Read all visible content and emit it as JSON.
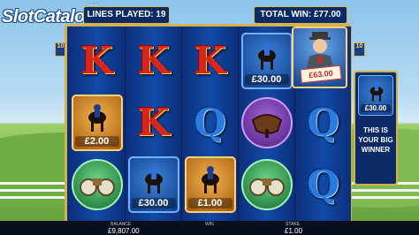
{
  "watermark": {
    "brand": "SlotCatalog",
    "suffix": ".com"
  },
  "header": {
    "lines_played_label": "LINES PLAYED:",
    "lines_played_value": "19",
    "total_win_label": "TOTAL WIN:",
    "total_win_value": "£77.00"
  },
  "winline_badges": {
    "left": "10",
    "right": "10"
  },
  "reels": [
    [
      {
        "kind": "letter",
        "value": "K"
      },
      {
        "kind": "horse",
        "prize": "£2.00",
        "style": "orange"
      },
      {
        "kind": "binoculars",
        "style": "green"
      }
    ],
    [
      {
        "kind": "letter",
        "value": "K"
      },
      {
        "kind": "letter",
        "value": "K"
      },
      {
        "kind": "horse",
        "prize": "£30.00",
        "style": "blue"
      }
    ],
    [
      {
        "kind": "letter",
        "value": "K"
      },
      {
        "kind": "letter",
        "value": "Q"
      },
      {
        "kind": "horse",
        "prize": "£1.00",
        "style": "orange"
      }
    ],
    [
      {
        "kind": "horse",
        "prize": "£30.00",
        "style": "blue"
      },
      {
        "kind": "saddle",
        "style": "purple"
      },
      {
        "kind": "binoculars",
        "style": "green"
      }
    ],
    [
      {
        "kind": "bookie",
        "prize": "£63.00"
      },
      {
        "kind": "letter",
        "value": "Q"
      },
      {
        "kind": "letter",
        "value": "Q"
      }
    ]
  ],
  "side_panel": {
    "prize": "£30.00",
    "message": "THIS IS YOUR BIG WINNER"
  },
  "footer": {
    "balance_label": "BALANCE",
    "balance_value": "£9,807.00",
    "win_label": "WIN",
    "win_value": "",
    "stake_label": "STAKE",
    "stake_value": "£1.00"
  },
  "colors": {
    "frame_gold": "#d6b04b",
    "reel_blue": "#124aa6",
    "letter_k": "#d8261f",
    "letter_q": "#2a7ae0"
  }
}
